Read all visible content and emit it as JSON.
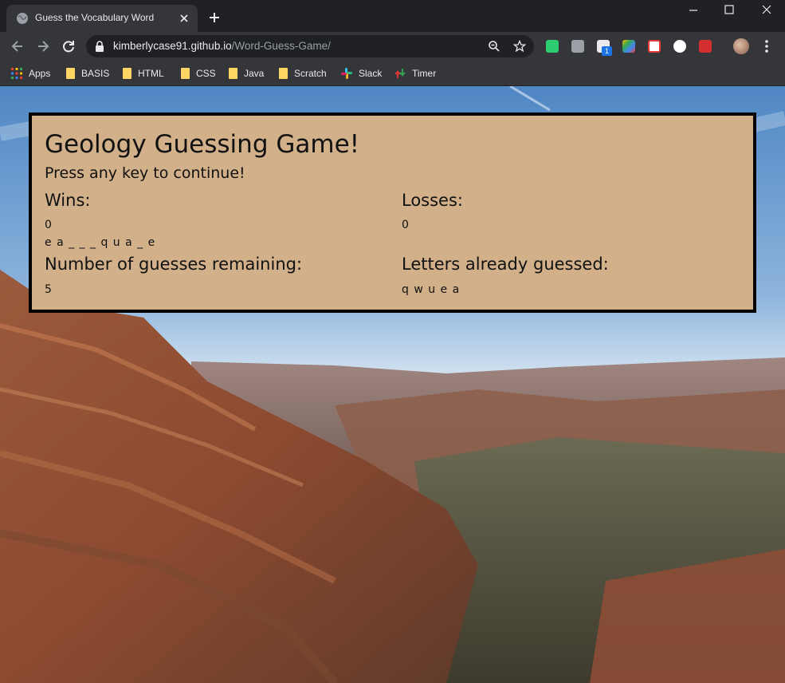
{
  "browser": {
    "tab_title": "Guess the Vocabulary Word",
    "url_host": "kimberlycase91.github.io",
    "url_path": "/Word-Guess-Game/",
    "bookmarks": [
      {
        "label": "Apps",
        "icon": "apps-grid-icon"
      },
      {
        "label": "BASIS",
        "icon": "folder-icon"
      },
      {
        "label": "HTML",
        "icon": "folder-icon"
      },
      {
        "label": "CSS",
        "icon": "folder-icon"
      },
      {
        "label": "Java",
        "icon": "folder-icon"
      },
      {
        "label": "Scratch",
        "icon": "folder-icon"
      },
      {
        "label": "Slack",
        "icon": "slack-icon"
      },
      {
        "label": "Timer",
        "icon": "timer-icon"
      }
    ],
    "extension_badge": "1"
  },
  "game": {
    "title": "Geology Guessing Game!",
    "instruction": "Press any key to continue!",
    "wins_label": "Wins:",
    "wins_value": "0",
    "losses_label": "Losses:",
    "losses_value": "0",
    "word_display": "e a _ _ _ q u a _ e",
    "guesses_label": "Number of guesses remaining:",
    "guesses_value": "5",
    "letters_label": "Letters already guessed:",
    "letters_value": "q w u e a"
  },
  "colors": {
    "panel_bg": "#d1b08a",
    "panel_border": "#000000",
    "chrome_dark": "#202124",
    "chrome_toolbar": "#35363a"
  }
}
